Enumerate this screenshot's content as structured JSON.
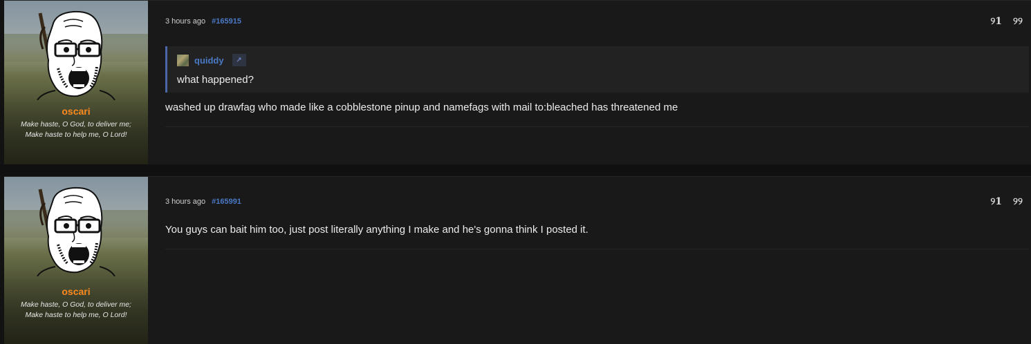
{
  "posts": [
    {
      "username": "oscari",
      "user_title": "Make haste, O God, to deliver me; Make haste to help me, O Lord!",
      "time": "3 hours ago",
      "post_number": "#165915",
      "quote": {
        "author": "quiddy",
        "link_icon": "↗",
        "text": "what happened?"
      },
      "body": "washed up drawfag who made like a cobblestone pinup and namefags with mail to:bleached has threatened me",
      "actions": {
        "reply_icon": "୨1",
        "quote_icon": "୨୨"
      }
    },
    {
      "username": "oscari",
      "user_title": "Make haste, O God, to deliver me; Make haste to help me, O Lord!",
      "time": "3 hours ago",
      "post_number": "#165991",
      "body": "You guys can bait him too, just post literally anything I make and he's gonna think I posted it.",
      "actions": {
        "reply_icon": "୨1",
        "quote_icon": "୨୨"
      }
    }
  ]
}
